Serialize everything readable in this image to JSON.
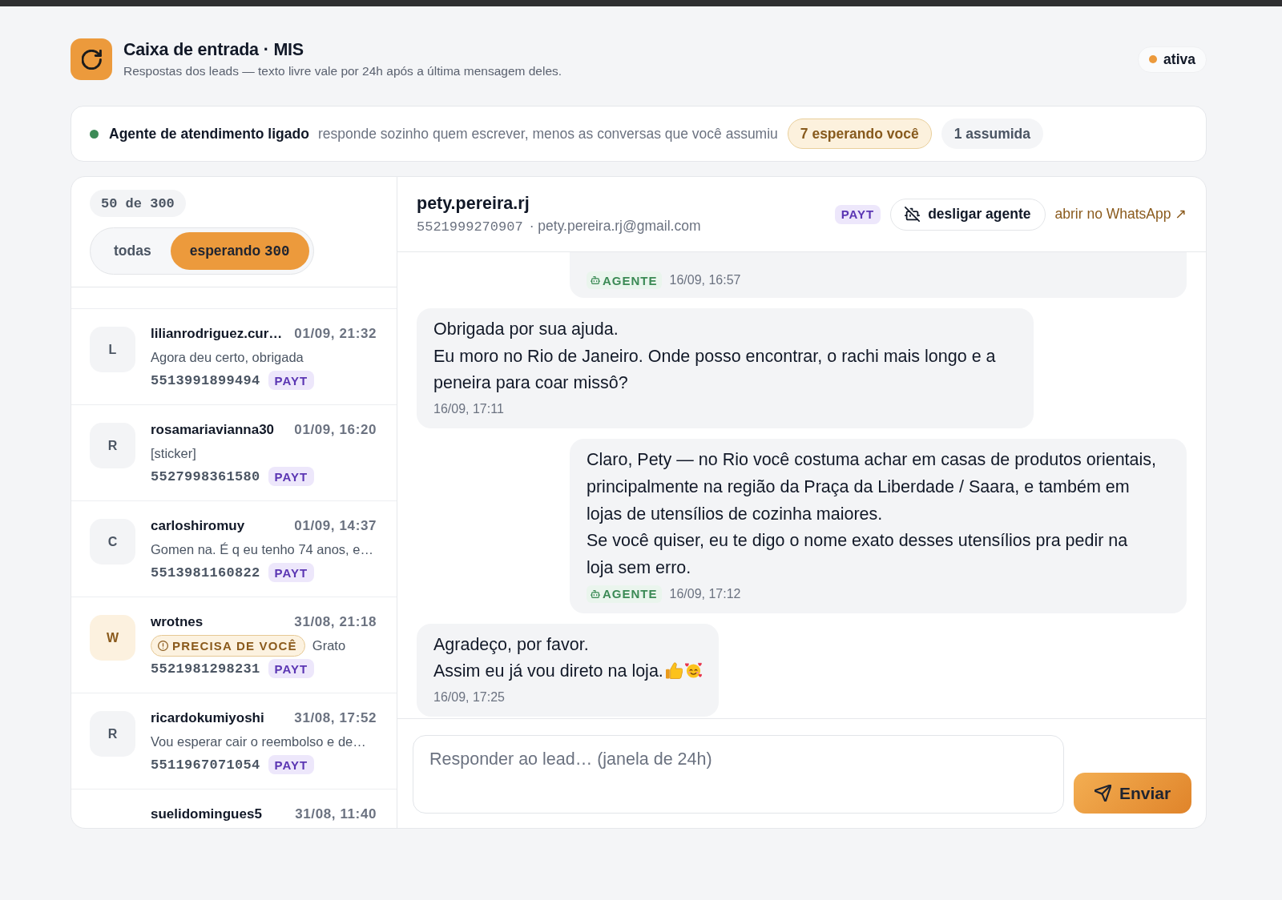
{
  "header": {
    "title": "Caixa de entrada · MIS",
    "subtitle": "Respostas dos leads — texto livre vale por 24h após a última mensagem deles.",
    "status": "ativa"
  },
  "agent_bar": {
    "on": true,
    "title": "Agente de atendimento ligado",
    "description": "responde sozinho quem escrever, menos as conversas que você assumiu",
    "pills": [
      {
        "kind": "waiting",
        "label": "7 esperando você"
      },
      {
        "kind": "claimed",
        "label": "1 assumida"
      }
    ]
  },
  "list": {
    "count": "50 de 300",
    "filters": [
      {
        "label": "todas",
        "selected": false
      },
      {
        "label": "esperando",
        "count": "300",
        "selected": true
      }
    ],
    "items": [
      {
        "initial": "L",
        "name": "lilianrodriguez.cur…",
        "time": "01/09, 21:32",
        "preview": "Agora deu certo, obrigada",
        "phone": "5513991899494",
        "tag": "PAYT",
        "selected": false
      },
      {
        "initial": "R",
        "name": "rosamariavianna30",
        "time": "01/09, 16:20",
        "preview": "[sticker]",
        "phone": "5527998361580",
        "tag": "PAYT",
        "selected": false
      },
      {
        "initial": "C",
        "name": "carloshiromuy",
        "time": "01/09, 14:37",
        "preview": "Gomen na. É q eu tenho 74 anos, e…",
        "phone": "5513981160822",
        "tag": "PAYT",
        "selected": false
      },
      {
        "initial": "W",
        "name": "wrotnes",
        "time": "31/08, 21:18",
        "alert": "PRECISA DE VOCÊ",
        "preview": "Grato",
        "phone": "5521981298231",
        "tag": "PAYT",
        "selected": false
      },
      {
        "initial": "R",
        "name": "ricardokumiyoshi",
        "time": "31/08, 17:52",
        "preview": "Vou esperar cair o reembolso e de…",
        "phone": "5511967071054",
        "tag": "PAYT",
        "selected": false
      },
      {
        "name": "suelidomingues5",
        "time": "31/08, 11:40",
        "selected": false
      }
    ]
  },
  "chat": {
    "name": "pety.pereira.rj",
    "phone": "5521999270907",
    "email": "· pety.pereira.rj@gmail.com",
    "tag": "PAYT",
    "agent_button": "desligar agente",
    "link": "abrir no WhatsApp ↗",
    "messages": [
      {
        "kind": "agent",
        "tag": "AGENTE",
        "time": "16/09, 16:57"
      },
      {
        "kind": "lead",
        "text": "Obrigada por sua ajuda.\nEu moro no Rio de Janeiro. Onde posso encontrar, o rachi mais longo e a peneira para coar missô?",
        "time": "16/09, 17:11"
      },
      {
        "kind": "agent",
        "text": "Claro, Pety — no Rio você costuma achar em casas de produtos orientais, principalmente na região da Praça da Liberdade / Saara, e também em lojas de utensílios de cozinha maiores.\nSe você quiser, eu te digo o nome exato desses utensílios pra pedir na loja sem erro.",
        "tag": "AGENTE",
        "time": "16/09, 17:12"
      },
      {
        "kind": "lead",
        "text": "Agradeço, por favor.\nAssim eu já vou direto na loja.",
        "emojis": [
          {
            "kind": "thumbs_up"
          },
          {
            "kind": "hearts_face"
          }
        ],
        "time": "16/09, 17:25"
      }
    ],
    "composer": {
      "placeholder": "Responder ao lead… (janela de 24h)",
      "send": "Enviar"
    }
  }
}
